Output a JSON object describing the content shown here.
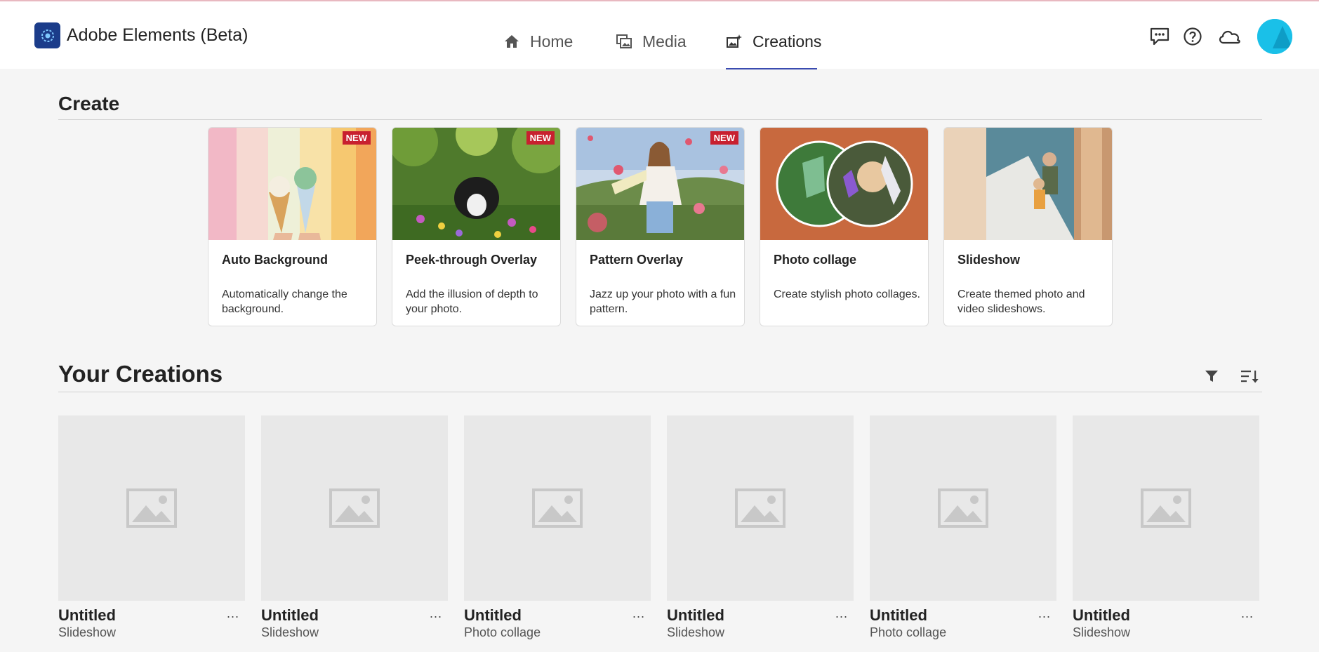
{
  "app": {
    "title": "Adobe Elements (Beta)"
  },
  "nav": {
    "tabs": [
      {
        "label": "Home",
        "icon": "home-icon"
      },
      {
        "label": "Media",
        "icon": "media-icon"
      },
      {
        "label": "Creations",
        "icon": "creations-icon",
        "active": true
      }
    ]
  },
  "header_icons": [
    "feedback-icon",
    "help-icon",
    "cloud-icon",
    "avatar"
  ],
  "create": {
    "title": "Create",
    "cards": [
      {
        "title": "Auto Background",
        "description": "Automatically change the background.",
        "badge": "NEW"
      },
      {
        "title": "Peek-through Overlay",
        "description": "Add the illusion of depth to your photo.",
        "badge": "NEW"
      },
      {
        "title": "Pattern Overlay",
        "description": "Jazz up your photo with a fun pattern.",
        "badge": "NEW"
      },
      {
        "title": "Photo collage",
        "description": "Create stylish photo collages."
      },
      {
        "title": "Slideshow",
        "description": "Create themed photo and video slideshows."
      }
    ]
  },
  "creations": {
    "title": "Your Creations",
    "tools": [
      "filter-icon",
      "sort-icon"
    ],
    "more_label": "...",
    "items": [
      {
        "title": "Untitled",
        "type": "Slideshow"
      },
      {
        "title": "Untitled",
        "type": "Slideshow"
      },
      {
        "title": "Untitled",
        "type": "Photo collage"
      },
      {
        "title": "Untitled",
        "type": "Slideshow"
      },
      {
        "title": "Untitled",
        "type": "Photo collage"
      },
      {
        "title": "Untitled",
        "type": "Slideshow"
      }
    ]
  },
  "colors": {
    "accent": "#3a4bb0",
    "badge": "#c8202f",
    "logo": "#1b3c8a",
    "avatar": "#1ac0e8"
  }
}
